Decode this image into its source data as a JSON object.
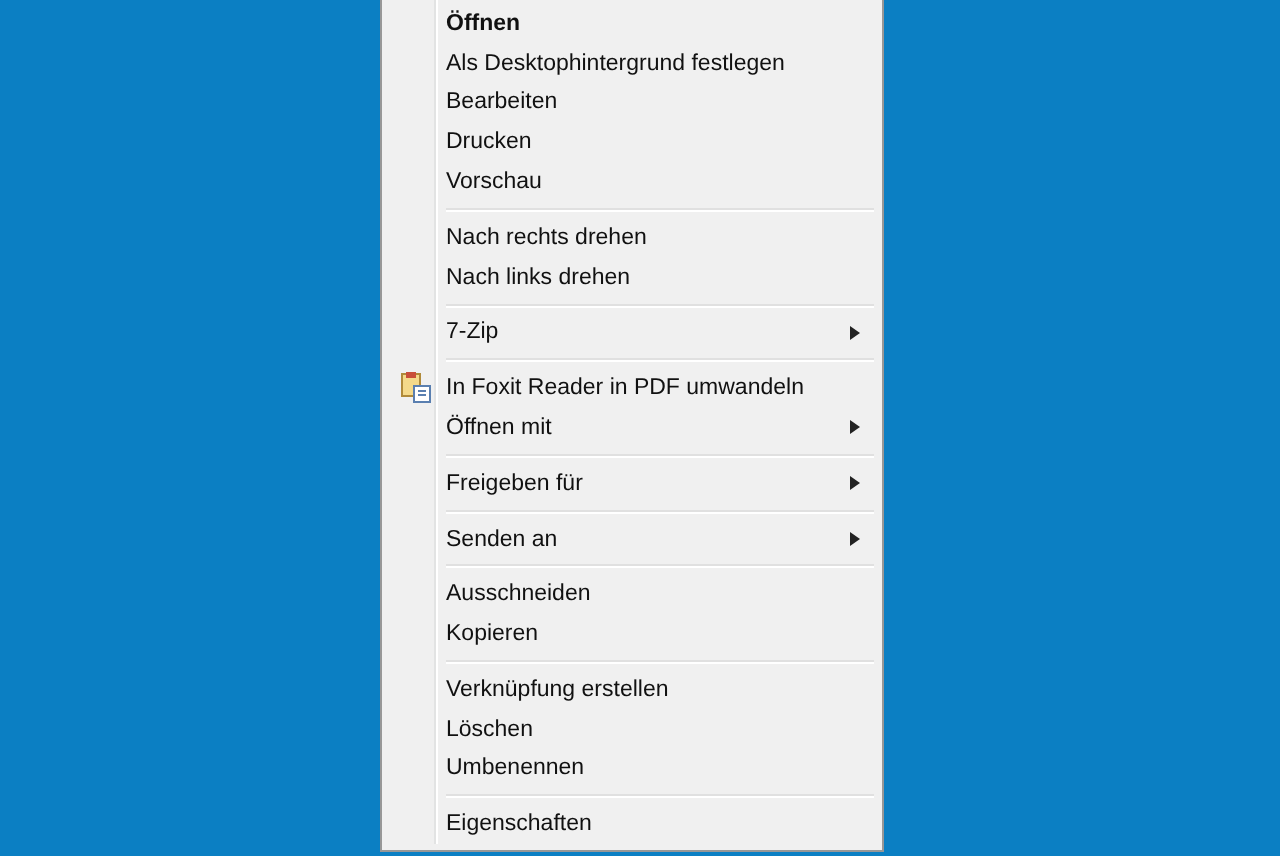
{
  "menu": {
    "groups": [
      [
        {
          "label": "Öffnen",
          "kind": "plain",
          "default": true,
          "submenu": false
        },
        {
          "label": "Als Desktophintergrund festlegen",
          "kind": "plain",
          "default": false,
          "submenu": false
        },
        {
          "label": "Bearbeiten",
          "kind": "plain",
          "default": false,
          "submenu": false
        },
        {
          "label": "Drucken",
          "kind": "plain",
          "default": false,
          "submenu": false
        },
        {
          "label": "Vorschau",
          "kind": "plain",
          "default": false,
          "submenu": false
        }
      ],
      [
        {
          "label": "Nach rechts drehen",
          "kind": "plain",
          "default": false,
          "submenu": false
        },
        {
          "label": "Nach links drehen",
          "kind": "plain",
          "default": false,
          "submenu": false
        }
      ],
      [
        {
          "label": "7-Zip",
          "kind": "plain",
          "default": false,
          "submenu": true
        }
      ],
      [
        {
          "label": "In Foxit Reader in PDF umwandeln",
          "kind": "icon",
          "default": false,
          "submenu": false
        },
        {
          "label": "Öffnen mit",
          "kind": "plain",
          "default": false,
          "submenu": true
        }
      ],
      [
        {
          "label": "Freigeben für",
          "kind": "plain",
          "default": false,
          "submenu": true
        }
      ],
      [
        {
          "label": "Senden an",
          "kind": "plain",
          "default": false,
          "submenu": true
        }
      ],
      [
        {
          "label": "Ausschneiden",
          "kind": "plain",
          "default": false,
          "submenu": false
        },
        {
          "label": "Kopieren",
          "kind": "plain",
          "default": false,
          "submenu": false
        }
      ],
      [
        {
          "label": "Verknüpfung erstellen",
          "kind": "plain",
          "default": false,
          "submenu": false
        },
        {
          "label": "Löschen",
          "kind": "plain",
          "default": false,
          "submenu": false
        },
        {
          "label": "Umbenennen",
          "kind": "plain",
          "default": false,
          "submenu": false
        }
      ],
      [
        {
          "label": "Eigenschaften",
          "kind": "plain",
          "default": false,
          "submenu": false
        }
      ]
    ]
  }
}
